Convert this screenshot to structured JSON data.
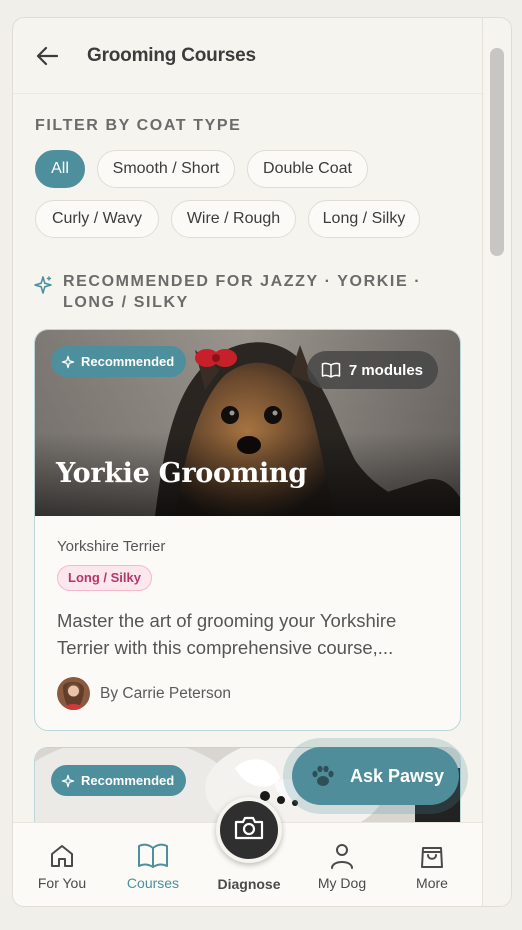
{
  "header": {
    "title": "Grooming Courses"
  },
  "filter": {
    "label": "FILTER BY COAT TYPE",
    "chips": [
      "All",
      "Smooth / Short",
      "Double Coat",
      "Curly / Wavy",
      "Wire / Rough",
      "Long / Silky"
    ],
    "selected": "All"
  },
  "recommended": {
    "heading": "RECOMMENDED FOR JAZZY · YORKIE · LONG / SILKY"
  },
  "cards": [
    {
      "badge": "Recommended",
      "modules": "7 modules",
      "title": "Yorkie Grooming",
      "breed": "Yorkshire Terrier",
      "coat": "Long / Silky",
      "description": "Master the art of grooming your Yorkshire Terrier with this comprehensive course,...",
      "author": "By Carrie Peterson"
    },
    {
      "badge": "Recommended"
    }
  ],
  "ask": {
    "label": "Ask Pawsy"
  },
  "nav": {
    "items": [
      {
        "label": "For You",
        "icon": "home-icon"
      },
      {
        "label": "Courses",
        "icon": "book-icon"
      },
      {
        "label": "Diagnose",
        "icon": "camera-icon"
      },
      {
        "label": "My Dog",
        "icon": "person-icon"
      },
      {
        "label": "More",
        "icon": "bag-icon"
      }
    ],
    "active": "Courses"
  },
  "colors": {
    "accent": "#4e8f9e",
    "coat_tag": "#b33865",
    "background": "#f6f4ee"
  }
}
